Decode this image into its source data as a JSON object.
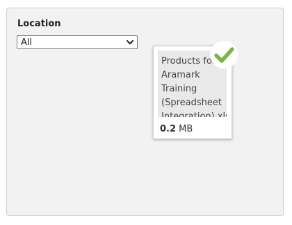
{
  "location": {
    "label": "Location",
    "selected": "All"
  },
  "file": {
    "name": "Products for Aramark Training (Spreadsheet Integration).xlsx",
    "size_value": "0.2",
    "size_unit": "MB",
    "status": "uploaded"
  },
  "icons": {
    "dropdown": "chevron-down-icon",
    "status": "checkmark-icon"
  },
  "colors": {
    "panel_bg": "#f2f2f2",
    "check": "#7ab648"
  }
}
